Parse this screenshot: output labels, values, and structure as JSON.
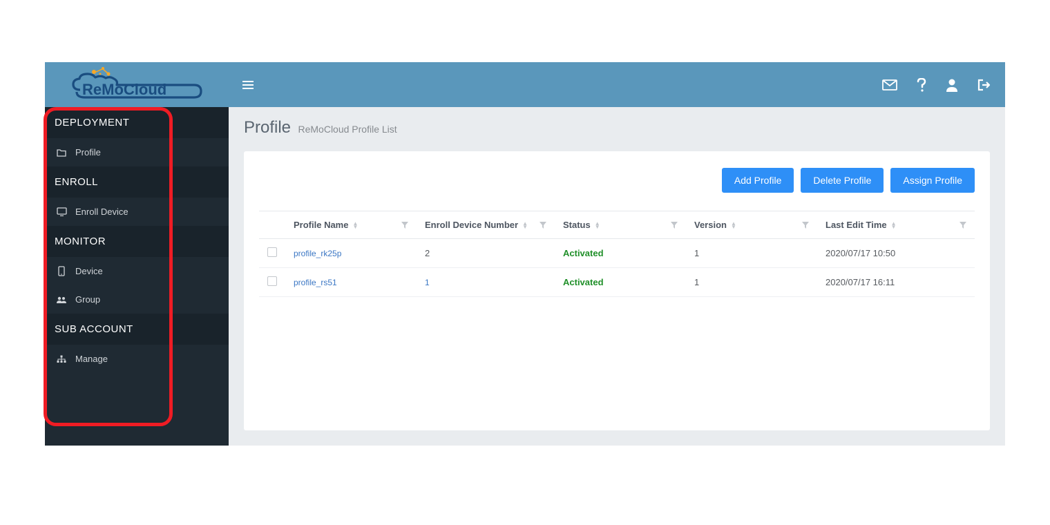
{
  "brand": {
    "name": "ReMoCloud"
  },
  "sidebar": {
    "sections": [
      {
        "title": "DEPLOYMENT",
        "items": [
          {
            "label": "Profile",
            "icon": "folder"
          }
        ]
      },
      {
        "title": "ENROLL",
        "items": [
          {
            "label": "Enroll Device",
            "icon": "monitor"
          }
        ]
      },
      {
        "title": "MONITOR",
        "items": [
          {
            "label": "Device",
            "icon": "phone"
          },
          {
            "label": "Group",
            "icon": "users"
          }
        ]
      },
      {
        "title": "SUB ACCOUNT",
        "items": [
          {
            "label": "Manage",
            "icon": "sitemap"
          }
        ]
      }
    ]
  },
  "page": {
    "title": "Profile",
    "subtitle": "ReMoCloud Profile List"
  },
  "actions": {
    "add": "Add Profile",
    "delete": "Delete Profile",
    "assign": "Assign Profile"
  },
  "table": {
    "columns": {
      "name": "Profile Name",
      "enroll": "Enroll Device Number",
      "status": "Status",
      "version": "Version",
      "last": "Last Edit Time"
    },
    "rows": [
      {
        "name": "profile_rk25p",
        "enroll": "2",
        "status": "Activated",
        "version": "1",
        "last": "2020/07/17 10:50"
      },
      {
        "name": "profile_rs51",
        "enroll": "1",
        "status": "Activated",
        "version": "1",
        "last": "2020/07/17 16:11"
      }
    ]
  }
}
